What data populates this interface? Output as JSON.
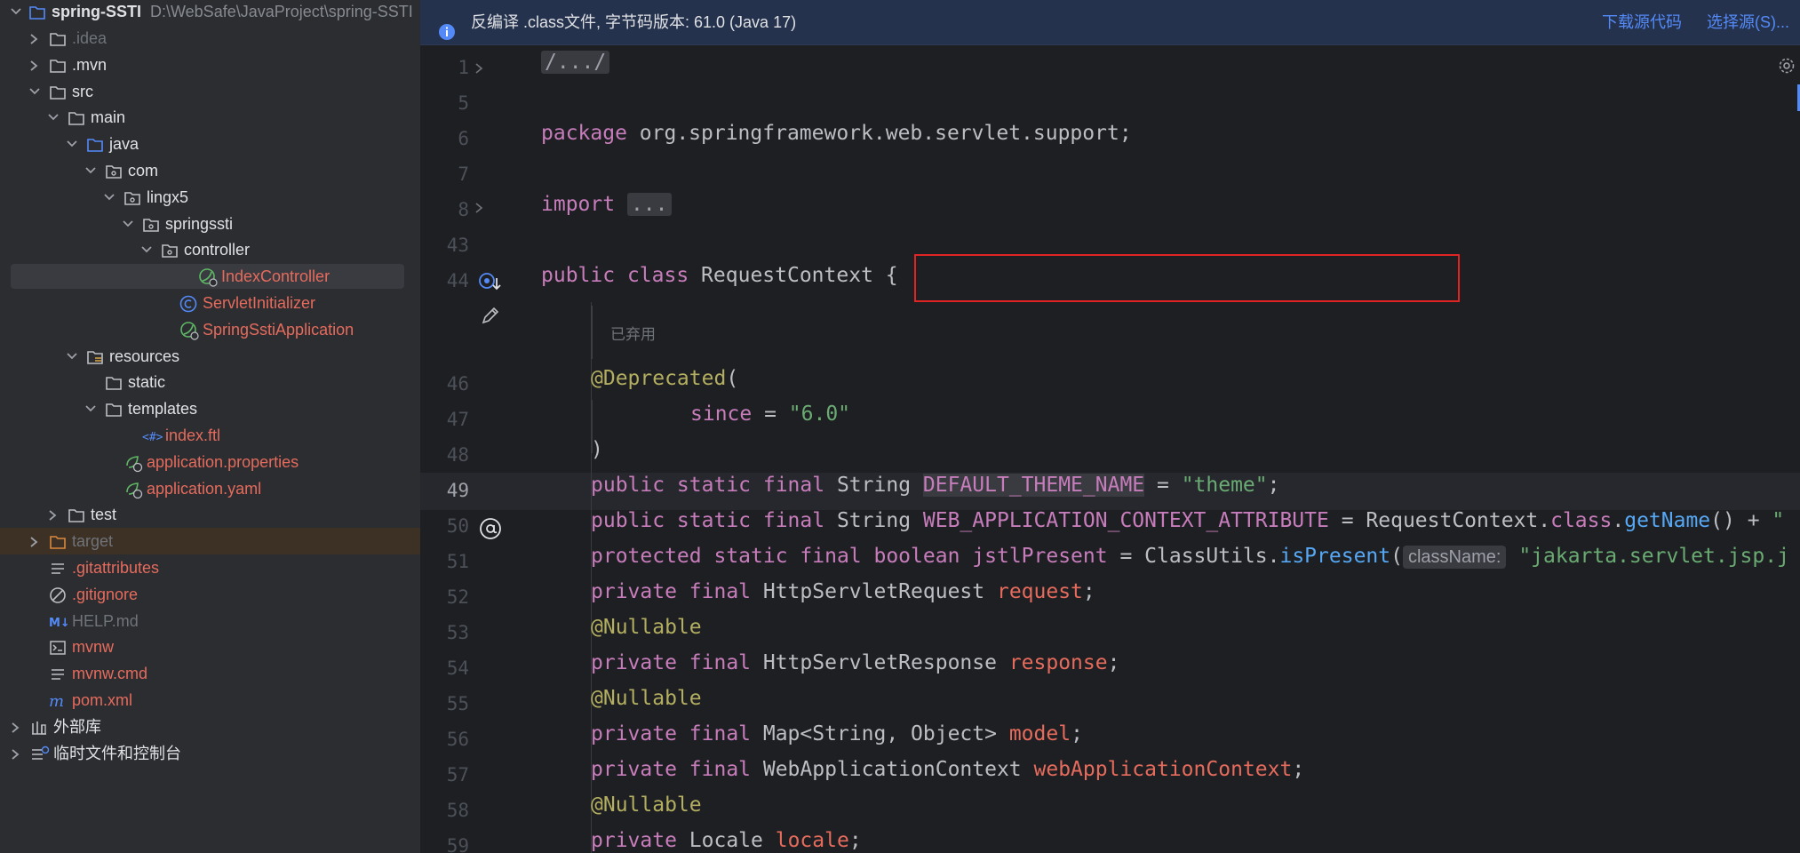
{
  "project": {
    "name": "spring-SSTI",
    "path": "D:\\WebSafe\\JavaProject\\spring-SSTI",
    "tree": [
      {
        "label": ".idea",
        "kind": "folder",
        "style": "grey",
        "depth": 1,
        "arrow": "right"
      },
      {
        "label": ".mvn",
        "kind": "folder",
        "style": "norm",
        "depth": 1,
        "arrow": "right"
      },
      {
        "label": "src",
        "kind": "folder",
        "style": "norm",
        "depth": 1,
        "arrow": "down"
      },
      {
        "label": "main",
        "kind": "folder",
        "style": "norm",
        "depth": 2,
        "arrow": "down"
      },
      {
        "label": "java",
        "kind": "src-folder",
        "style": "norm",
        "depth": 3,
        "arrow": "down"
      },
      {
        "label": "com",
        "kind": "package",
        "style": "norm",
        "depth": 4,
        "arrow": "down"
      },
      {
        "label": "lingx5",
        "kind": "package",
        "style": "norm",
        "depth": 5,
        "arrow": "down"
      },
      {
        "label": "springssti",
        "kind": "package",
        "style": "norm",
        "depth": 6,
        "arrow": "down"
      },
      {
        "label": "controller",
        "kind": "package",
        "style": "norm",
        "depth": 7,
        "arrow": "down"
      },
      {
        "label": "IndexController",
        "kind": "spring-bean",
        "style": "red",
        "depth": 9,
        "arrow": "none",
        "selected": true
      },
      {
        "label": "ServletInitializer",
        "kind": "class",
        "style": "red",
        "depth": 8,
        "arrow": "none"
      },
      {
        "label": "SpringSstiApplication",
        "kind": "spring-bean",
        "style": "red",
        "depth": 8,
        "arrow": "none"
      },
      {
        "label": "resources",
        "kind": "res-folder",
        "style": "norm",
        "depth": 3,
        "arrow": "down"
      },
      {
        "label": "static",
        "kind": "folder",
        "style": "norm",
        "depth": 4,
        "arrow": "none"
      },
      {
        "label": "templates",
        "kind": "folder",
        "style": "norm",
        "depth": 4,
        "arrow": "down"
      },
      {
        "label": "index.ftl",
        "kind": "ftl",
        "style": "red",
        "depth": 6,
        "arrow": "none"
      },
      {
        "label": "application.properties",
        "kind": "spring-config",
        "style": "red",
        "depth": 5,
        "arrow": "none"
      },
      {
        "label": "application.yaml",
        "kind": "spring-config",
        "style": "red",
        "depth": 5,
        "arrow": "none"
      },
      {
        "label": "test",
        "kind": "folder",
        "style": "norm",
        "depth": 2,
        "arrow": "right"
      },
      {
        "label": "target",
        "kind": "folder-excluded",
        "style": "grey",
        "depth": 1,
        "arrow": "right",
        "excluded": true
      },
      {
        "label": ".gitattributes",
        "kind": "text",
        "style": "red",
        "depth": 1,
        "arrow": "none"
      },
      {
        "label": ".gitignore",
        "kind": "ignore",
        "style": "red",
        "depth": 1,
        "arrow": "none"
      },
      {
        "label": "HELP.md",
        "kind": "markdown",
        "style": "grey",
        "depth": 1,
        "arrow": "none"
      },
      {
        "label": "mvnw",
        "kind": "shell",
        "style": "red",
        "depth": 1,
        "arrow": "none"
      },
      {
        "label": "mvnw.cmd",
        "kind": "text",
        "style": "red",
        "depth": 1,
        "arrow": "none"
      },
      {
        "label": "pom.xml",
        "kind": "maven",
        "style": "red",
        "depth": 1,
        "arrow": "none"
      },
      {
        "label": "外部库",
        "kind": "library",
        "style": "norm",
        "depth": 0,
        "arrow": "right"
      },
      {
        "label": "临时文件和控制台",
        "kind": "scratch",
        "style": "norm",
        "depth": 0,
        "arrow": "right"
      }
    ]
  },
  "banner": {
    "message": "反编译 .class文件, 字节码版本: 61.0 (Java 17)",
    "download_source": "下载源代码",
    "choose_source": "选择源(S)..."
  },
  "editor": {
    "current_line": "49",
    "deprecated_doc": "已弃用",
    "lines": [
      {
        "num": "1",
        "tokens": [
          [
            "fold",
            "/.../"
          ]
        ]
      },
      {
        "num": "5",
        "tokens": []
      },
      {
        "num": "6",
        "tokens": [
          [
            "kw2",
            "package"
          ],
          [
            "plain",
            " org.springframework.web.servlet.support;"
          ]
        ]
      },
      {
        "num": "7",
        "tokens": []
      },
      {
        "num": "8",
        "tokens": [
          [
            "kw2",
            "import"
          ],
          [
            "plain",
            " "
          ],
          [
            "fold",
            "..."
          ]
        ]
      },
      {
        "num": "43",
        "tokens": []
      },
      {
        "num": "44",
        "tokens": [
          [
            "kw2",
            "public"
          ],
          [
            "plain",
            " "
          ],
          [
            "kw2",
            "class"
          ],
          [
            "plain",
            " RequestContext {"
          ]
        ]
      },
      {
        "num": "46",
        "tokens": [
          [
            "ann",
            "@Deprecated"
          ],
          [
            "plain",
            "("
          ]
        ]
      },
      {
        "num": "47",
        "tokens": [
          [
            "fld",
            "since"
          ],
          [
            "plain",
            " = "
          ],
          [
            "str",
            "\"6.0\""
          ]
        ]
      },
      {
        "num": "48",
        "tokens": [
          [
            "plain",
            ")"
          ]
        ]
      },
      {
        "num": "49",
        "tokens": [
          [
            "kw2",
            "public static final"
          ],
          [
            "plain",
            " String "
          ],
          [
            "fldbox",
            "DEFAULT_THEME_NAME"
          ],
          [
            "plain",
            " = "
          ],
          [
            "str",
            "\"theme\""
          ],
          [
            "plain",
            ";"
          ]
        ]
      },
      {
        "num": "50",
        "tokens": [
          [
            "kw2",
            "public static final"
          ],
          [
            "plain",
            " String "
          ],
          [
            "fld",
            "WEB_APPLICATION_CONTEXT_ATTRIBUTE"
          ],
          [
            "plain",
            " = RequestContext."
          ],
          [
            "kw2",
            "class"
          ],
          [
            "plain",
            "."
          ],
          [
            "mth",
            "getName"
          ],
          [
            "plain",
            "() + "
          ],
          [
            "str",
            "\""
          ]
        ]
      },
      {
        "num": "51",
        "tokens": [
          [
            "kw2",
            "protected static final boolean"
          ],
          [
            "plain",
            " "
          ],
          [
            "fld",
            "jstlPresent"
          ],
          [
            "plain",
            " = ClassUtils."
          ],
          [
            "mth",
            "isPresent"
          ],
          [
            "plain",
            "("
          ],
          [
            "hint",
            "className:"
          ],
          [
            "plain",
            " "
          ],
          [
            "str",
            "\"jakarta.servlet.jsp.j"
          ]
        ]
      },
      {
        "num": "52",
        "tokens": [
          [
            "kw2",
            "private final"
          ],
          [
            "plain",
            " HttpServletRequest "
          ],
          [
            "fldr",
            "request"
          ],
          [
            "plain",
            ";"
          ]
        ]
      },
      {
        "num": "53",
        "tokens": [
          [
            "ann",
            "@Nullable"
          ]
        ]
      },
      {
        "num": "54",
        "tokens": [
          [
            "kw2",
            "private final"
          ],
          [
            "plain",
            " HttpServletResponse "
          ],
          [
            "fldr",
            "response"
          ],
          [
            "plain",
            ";"
          ]
        ]
      },
      {
        "num": "55",
        "tokens": [
          [
            "ann",
            "@Nullable"
          ]
        ]
      },
      {
        "num": "56",
        "tokens": [
          [
            "kw2",
            "private final"
          ],
          [
            "plain",
            " Map<String, Object> "
          ],
          [
            "fldr",
            "model"
          ],
          [
            "plain",
            ";"
          ]
        ]
      },
      {
        "num": "57",
        "tokens": [
          [
            "kw2",
            "private final"
          ],
          [
            "plain",
            " WebApplicationContext "
          ],
          [
            "fldr",
            "webApplicationContext"
          ],
          [
            "plain",
            ";"
          ]
        ]
      },
      {
        "num": "58",
        "tokens": [
          [
            "ann",
            "@Nullable"
          ]
        ]
      },
      {
        "num": "59",
        "tokens": [
          [
            "kw2",
            "private"
          ],
          [
            "plain",
            " Locale "
          ],
          [
            "fldr",
            "locale"
          ],
          [
            "plain",
            ";"
          ]
        ]
      }
    ]
  }
}
